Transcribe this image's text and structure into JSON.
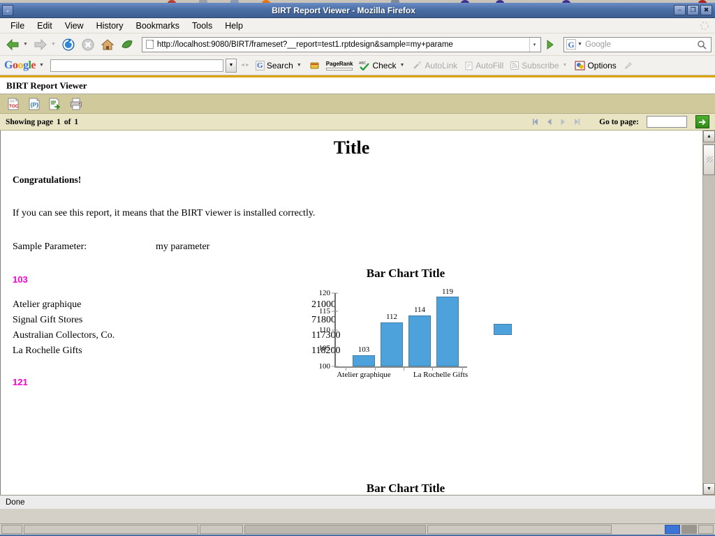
{
  "window": {
    "title": "BIRT Report Viewer - Mozilla Firefox",
    "menu_button": "⌄",
    "minimize": "–",
    "restore": "❐",
    "close": "✖"
  },
  "menu_bar": {
    "items": [
      {
        "label": "File",
        "accel": "F"
      },
      {
        "label": "Edit",
        "accel": "E"
      },
      {
        "label": "View",
        "accel": "V"
      },
      {
        "label": "History",
        "accel": "s"
      },
      {
        "label": "Bookmarks",
        "accel": "B"
      },
      {
        "label": "Tools",
        "accel": "T"
      },
      {
        "label": "Help",
        "accel": "H"
      }
    ]
  },
  "nav_bar": {
    "back_icon": "back-arrow-icon",
    "forward_icon": "forward-arrow-icon",
    "reload_icon": "reload-icon",
    "stop_icon": "stop-icon",
    "home_icon": "home-icon",
    "leaf_icon": "leaf-icon",
    "url": "http://localhost:9080/BIRT/frameset?__report=test1.rptdesign&sample=my+parame",
    "url_dropdown": "▾",
    "go_icon": "go-arrow-icon",
    "search_engine": "G",
    "search_placeholder": "Google",
    "search_value": ""
  },
  "google_toolbar": {
    "logo": [
      "G",
      "o",
      "o",
      "g",
      "l",
      "e"
    ],
    "logo_caret": "▾",
    "search_value": "",
    "search_placeholder": "",
    "buttons": [
      {
        "label": "Search",
        "icon": "google-g-icon",
        "enabled": true,
        "caret": "▾"
      },
      {
        "label": "",
        "icon": "bookmark-star-icon",
        "enabled": true,
        "caret": ""
      },
      {
        "label": "PageRank",
        "icon": "pagerank-icon",
        "enabled": true,
        "caret": ""
      },
      {
        "label": "Check",
        "icon": "spellcheck-icon",
        "enabled": true,
        "caret": "▾"
      },
      {
        "label": "AutoLink",
        "icon": "autolink-icon",
        "enabled": false,
        "caret": ""
      },
      {
        "label": "AutoFill",
        "icon": "autofill-icon",
        "enabled": false,
        "caret": ""
      },
      {
        "label": "Subscribe",
        "icon": "rss-icon",
        "enabled": false,
        "caret": "▾"
      },
      {
        "label": "Options",
        "icon": "options-icon",
        "enabled": true,
        "caret": ""
      },
      {
        "label": "",
        "icon": "highlighter-icon",
        "enabled": false,
        "caret": ""
      }
    ]
  },
  "birt": {
    "app_title": "BIRT Report Viewer",
    "toolbar": [
      {
        "name": "toc-button",
        "label": "TOC"
      },
      {
        "name": "parameters-button",
        "label": "{P}"
      },
      {
        "name": "export-report-button",
        "label": "Export"
      },
      {
        "name": "print-report-button",
        "label": "Print"
      }
    ],
    "status": {
      "showing_prefix": "Showing page",
      "current_page": "1",
      "of": "of",
      "total_pages": "1"
    },
    "pagination": {
      "first": "⏮",
      "previous": "◀",
      "next": "▶",
      "last": "⏭",
      "goto_label": "Go to page:",
      "goto_value": "",
      "go_button": "➜"
    }
  },
  "report": {
    "title": "Title",
    "congratulations": "Congratulations!",
    "intro": "If you can see this report, it means that the BIRT viewer is installed correctly.",
    "param_label": "Sample Parameter:",
    "param_value": "my parameter",
    "group_value_1": "103",
    "group_value_2": "121",
    "group_color": "#ff00cc",
    "table": {
      "rows": [
        {
          "name": "Atelier graphique",
          "value": "21000"
        },
        {
          "name": "Signal Gift Stores",
          "value": "71800"
        },
        {
          "name": "Australian Collectors, Co.",
          "value": "117300"
        },
        {
          "name": "La Rochelle Gifts",
          "value": "118200"
        }
      ]
    }
  },
  "chart_data": {
    "type": "bar",
    "title": "Bar Chart Title",
    "categories": [
      "Atelier graphique",
      "",
      "",
      "La Rochelle Gifts"
    ],
    "tick_labels_shown": [
      "Atelier graphique",
      "La Rochelle Gifts"
    ],
    "values": [
      103,
      112,
      114,
      119
    ],
    "data_labels": [
      "103",
      "112",
      "114",
      "119"
    ],
    "xlabel": "",
    "ylabel": "",
    "ylim": [
      100,
      120
    ],
    "yticks": [
      100,
      105,
      110,
      115,
      120
    ],
    "ytick_labels": [
      "100",
      "105",
      "110",
      "115",
      "120"
    ],
    "grid": false,
    "legend": {
      "position": "right",
      "entries": [
        {
          "label": "",
          "color": "#4da2dc"
        }
      ]
    },
    "bar_color": "#4da2dc"
  },
  "chart_bottom": {
    "type": "bar",
    "title": "Bar Chart Title"
  },
  "status_bar": {
    "text": "Done"
  }
}
